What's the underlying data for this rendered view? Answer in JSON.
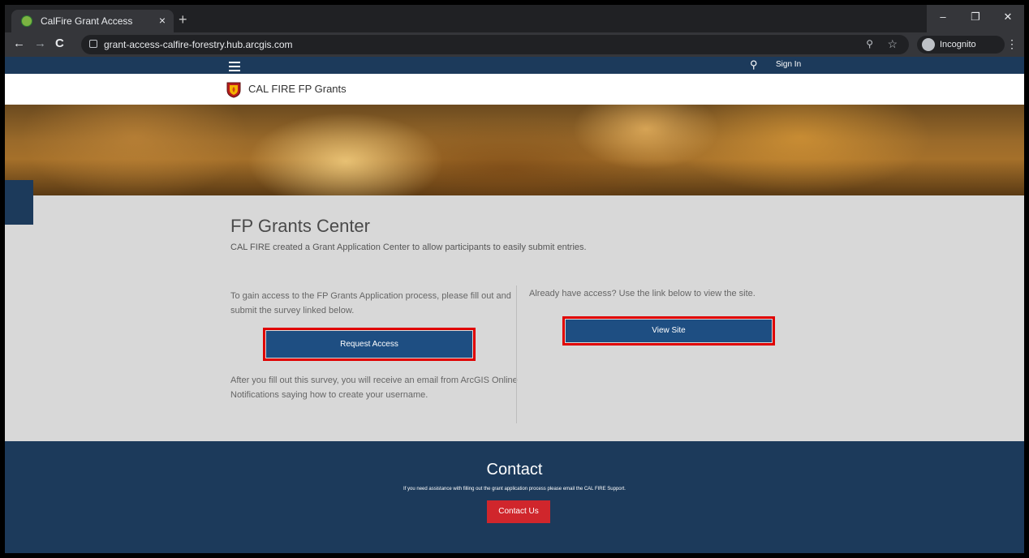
{
  "browser": {
    "tab_title": "CalFire Grant Access",
    "tab_close": "×",
    "new_tab": "+",
    "url": "grant-access-calfire-forestry.hub.arcgis.com",
    "incognito_label": "Incognito",
    "window_controls": {
      "minimize": "–",
      "maximize": "❐",
      "close": "✕"
    },
    "nav": {
      "back": "←",
      "forward": "→",
      "reload": "C"
    },
    "zoom_icon": "⚲",
    "star_icon": "☆",
    "menu_icon": "⋮"
  },
  "site": {
    "nav": {
      "search_icon": "⚲",
      "sign_in": "Sign In"
    },
    "title": "CAL FIRE FP Grants"
  },
  "main": {
    "heading": "FP Grants Center",
    "subheading": "CAL FIRE created a Grant Application Center to allow participants to easily submit entries.",
    "left_text": "To gain access to the FP Grants Application process, please fill out and submit the survey linked below.",
    "request_button": "Request Access",
    "after_text": "After you fill out this survey, you will receive an email from ArcGIS Online Notifications saying how to create your username.",
    "right_text": "Already have access? Use the link below to view the site.",
    "view_button": "View Site"
  },
  "footer": {
    "title": "Contact",
    "text": "If you need assistance with filling out the grant application process please email the CAL FIRE Support.",
    "button": "Contact Us"
  },
  "colors": {
    "nav_blue": "#1c3a5b",
    "button_blue": "#1e4e82",
    "contact_red": "#d0262c",
    "highlight_red": "#e00000"
  }
}
